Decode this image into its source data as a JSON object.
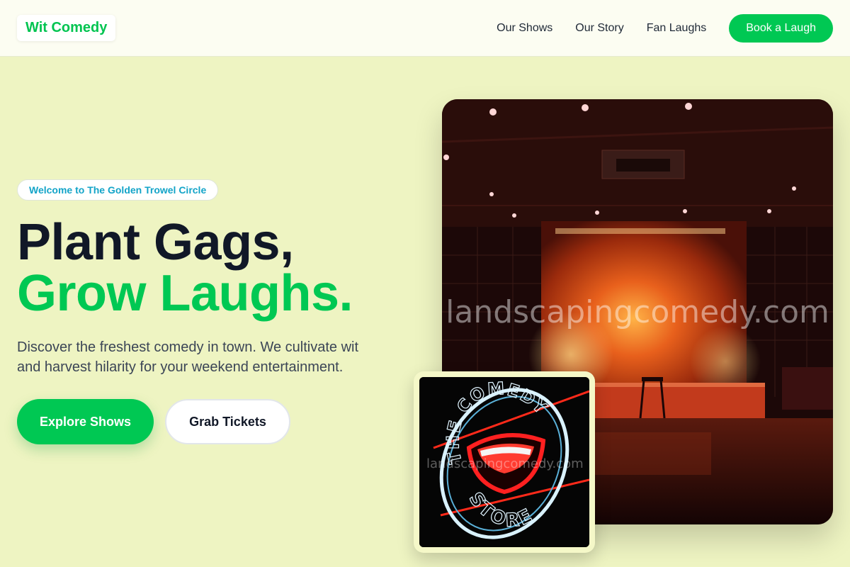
{
  "header": {
    "logo": "Wit Comedy",
    "nav": [
      "Our Shows",
      "Our Story",
      "Fan Laughs"
    ],
    "cta": "Book a Laugh"
  },
  "hero": {
    "badge": "Welcome to The Golden Trowel Circle",
    "headline_line1": "Plant Gags,",
    "headline_line2": "Grow Laughs.",
    "subtext": "Discover the freshest comedy in town. We cultivate wit and harvest hilarity for your weekend entertainment.",
    "primary_button": "Explore Shows",
    "secondary_button": "Grab Tickets"
  },
  "images": {
    "main_watermark": "landscapingcomedy.com",
    "small_watermark": "landscapingcomedy.com",
    "sign_top": "THE COMEDY",
    "sign_bottom": "STORE"
  },
  "colors": {
    "accent": "#00c853",
    "background": "#eef4c2",
    "badge_text": "#13a4c8",
    "heading": "#111827"
  }
}
